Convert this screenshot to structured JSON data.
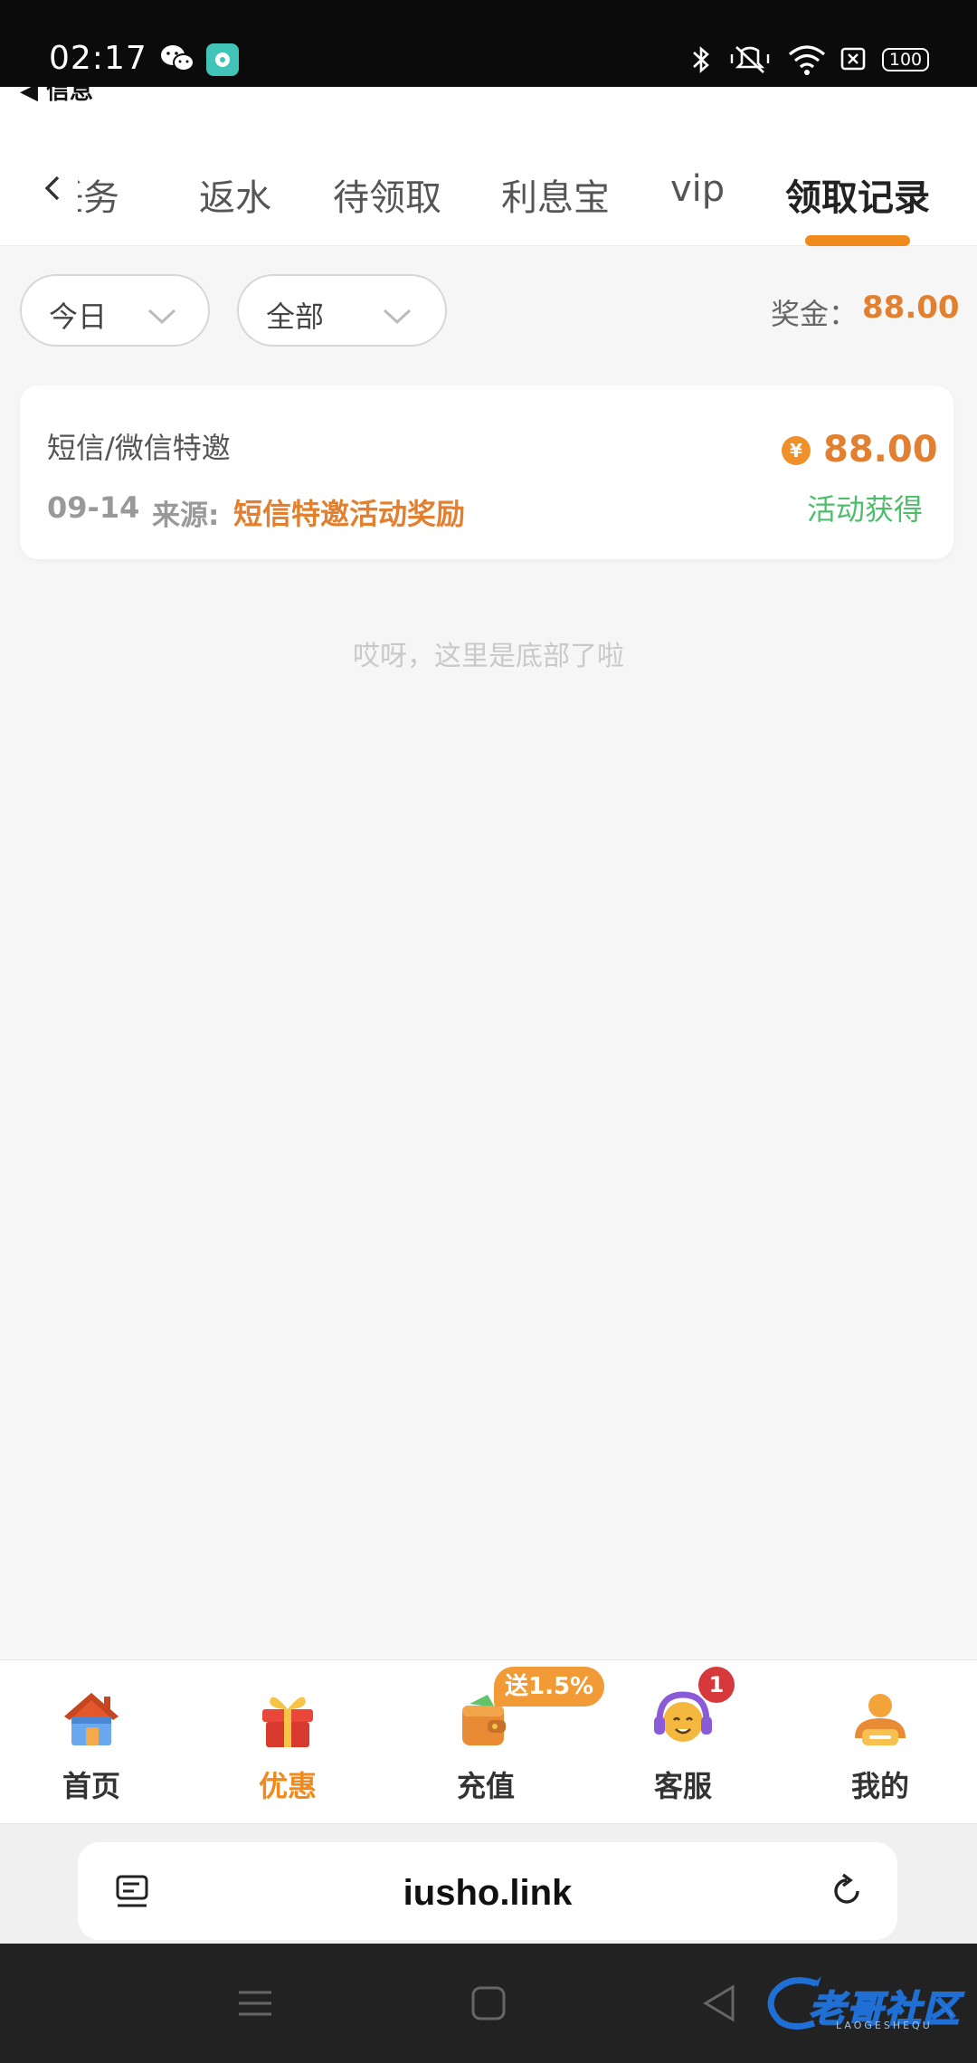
{
  "status_bar": {
    "time": "02:17",
    "battery": "100"
  },
  "header": {
    "back_label": "◀ 信息",
    "tabs": [
      {
        "label": "任务"
      },
      {
        "label": "返水"
      },
      {
        "label": "待领取"
      },
      {
        "label": "利息宝"
      },
      {
        "label": "vip"
      },
      {
        "label": "领取记录"
      }
    ],
    "active_tab": "领取记录"
  },
  "filters": {
    "date": "今日",
    "type": "全部",
    "bonus_label": "奖金：",
    "bonus_value": "88.00"
  },
  "records": [
    {
      "title": "短信/微信特邀",
      "date": "09-14",
      "source_label": "来源:",
      "source": "短信特邀活动奖励",
      "currency_symbol": "¥",
      "amount": "88.00",
      "status": "活动获得"
    }
  ],
  "end_text": "哎呀，这里是底部了啦",
  "bottom_nav": {
    "items": [
      {
        "label": "首页",
        "icon": "house-icon"
      },
      {
        "label": "优惠",
        "icon": "gift-icon"
      },
      {
        "label": "充值",
        "icon": "wallet-icon"
      },
      {
        "label": "客服",
        "icon": "headset-icon"
      },
      {
        "label": "我的",
        "icon": "profile-icon"
      }
    ],
    "active": "优惠",
    "deposit_tag": "送1.5%",
    "service_badge": "1"
  },
  "browser": {
    "url": "iusho.link"
  },
  "watermark": {
    "text": "老哥社区",
    "sub": "LAOGESHEQU"
  },
  "colors": {
    "accent_orange": "#f08a1c",
    "amount_orange": "#e2802f",
    "status_green": "#4fbe6b"
  }
}
